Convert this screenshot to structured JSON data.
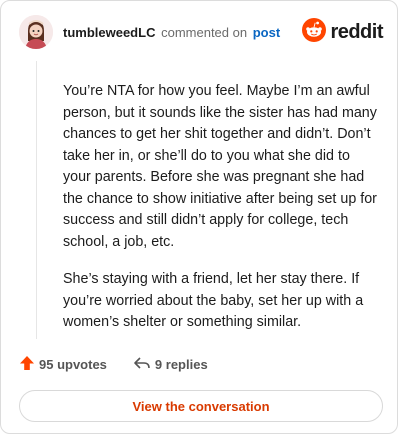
{
  "comment": {
    "username": "tumbleweedLC",
    "commented_text": "commented on",
    "post_link": "post",
    "paragraphs": [
      "You’re NTA for how you feel. Maybe I’m an awful person, but it sounds like the sister has had many chances to get her shit together and didn’t. Don’t take her in, or she’ll do to you what she did to your parents. Before she was pregnant she had the chance to show initiative after being set up for success and still didn’t apply for college, tech school, a job, etc.",
      "She’s staying with a friend, let her stay there. If you’re worried about the baby, set her up with a women’s shelter or something similar."
    ],
    "upvotes_label": "95 upvotes",
    "replies_label": "9 replies"
  },
  "brand": {
    "name": "reddit",
    "color": "#ff4500"
  },
  "cta": {
    "label": "View the conversation",
    "color": "#d93a00"
  },
  "icons": {
    "upvote": "upvote-arrow-icon",
    "reply": "reply-arrow-icon",
    "logo": "reddit-alien-icon"
  }
}
